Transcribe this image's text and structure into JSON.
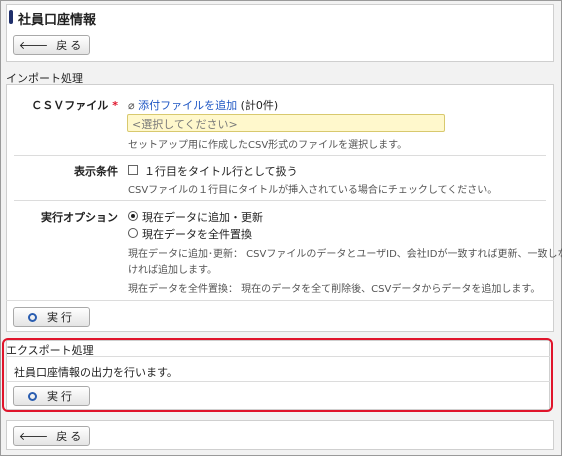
{
  "page": {
    "title": "社員口座情報",
    "back_label": "戻る"
  },
  "import": {
    "section_label": "インポート処理",
    "csv": {
      "label": "ＣＳＶファイル",
      "required_mark": "*",
      "add_link": "添付ファイルを追加",
      "count": "(計0件)",
      "placeholder": "<選択してください>",
      "help": "セットアップ用に作成したCSV形式のファイルを選択します。"
    },
    "display": {
      "label": "表示条件",
      "checkbox_label": "１行目をタイトル行として扱う",
      "help": "CSVファイルの１行目にタイトルが挿入されている場合にチェックしてください。"
    },
    "options": {
      "label": "実行オプション",
      "radio1": "現在データに追加・更新",
      "radio2": "現在データを全件置換",
      "help1": "現在データに追加･更新： CSVファイルのデータとユーザID、会社IDが一致すれば更新、一致しな",
      "help1b": "ければ追加します。",
      "help2": "現在データを全件置換： 現在のデータを全て削除後、CSVデータからデータを追加します。"
    },
    "execute_label": "実行"
  },
  "export": {
    "section_label": "エクスポート処理",
    "description": "社員口座情報の出力を行います。",
    "execute_label": "実行"
  },
  "icons": {
    "back": "arrow-left-icon",
    "execute": "circle-icon",
    "attach": "paperclip-icon"
  },
  "colors": {
    "highlight": "#e0142b",
    "link": "#1e56c4",
    "title_bar": "#1f2f6b"
  }
}
